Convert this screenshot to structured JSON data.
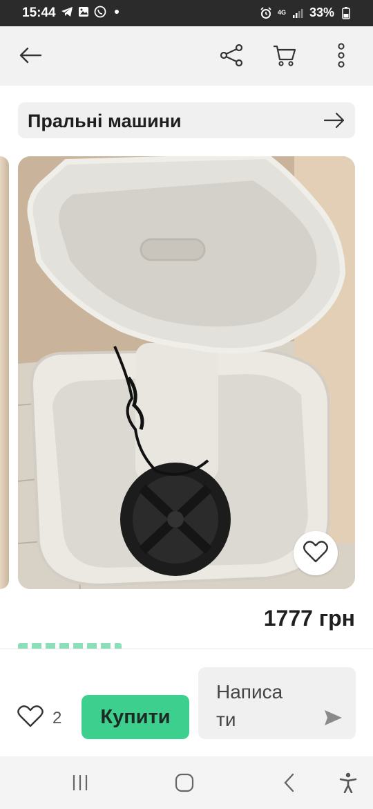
{
  "status_bar": {
    "time": "15:44",
    "network": "4G",
    "battery": "33%",
    "icons": [
      "telegram-icon",
      "gallery-icon",
      "viber-icon",
      "dot-icon",
      "alarm-icon",
      "signal-icon",
      "battery-icon"
    ]
  },
  "app_bar": {
    "icons": [
      "back-arrow-icon",
      "share-icon",
      "cart-icon",
      "more-vertical-icon"
    ]
  },
  "category": {
    "label": "Пральні машини",
    "icon": "arrow-right-icon"
  },
  "gallery": {
    "favorite_icon": "heart-icon"
  },
  "listing": {
    "price": "1777 грн"
  },
  "actions": {
    "likes_count": "2",
    "buy_label": "Купити",
    "message_label": "Написати",
    "message_label_lines": [
      "Написа",
      "ти"
    ],
    "send_icon": "send-icon"
  },
  "nav": {
    "icons": [
      "recent-apps-icon",
      "home-icon",
      "back-icon",
      "accessibility-icon"
    ]
  },
  "colors": {
    "accent_green": "#3ccf8e",
    "status_bar_bg": "#2b2b2b",
    "app_bar_bg": "#f2f2f2"
  }
}
